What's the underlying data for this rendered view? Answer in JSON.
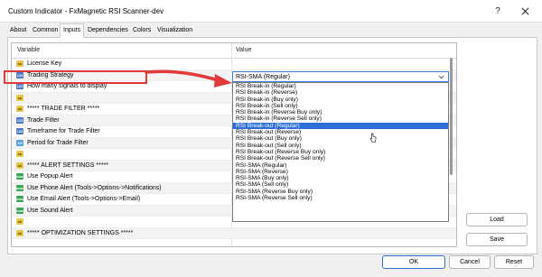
{
  "window": {
    "title": "Custom Indicator - FxMagnetic RSI Scanner-dev",
    "help": "?",
    "close_icon": "close-icon"
  },
  "tabs": [
    {
      "label": "About",
      "active": false
    },
    {
      "label": "Common",
      "active": false
    },
    {
      "label": "Inputs",
      "active": true
    },
    {
      "label": "Dependencies",
      "active": false
    },
    {
      "label": "Colors",
      "active": false
    },
    {
      "label": "Visualization",
      "active": false
    }
  ],
  "grid": {
    "header_variable": "Variable",
    "header_value": "Value",
    "rows": [
      {
        "icon": "ab",
        "label": "License Key",
        "value": ""
      },
      {
        "icon": "123",
        "label": "Trading Strategy",
        "value": "RSI-SMA (Regular)"
      },
      {
        "icon": "123",
        "label": "How many signals to display",
        "value": ""
      },
      {
        "icon": "ab",
        "label": "",
        "value": ""
      },
      {
        "icon": "ab",
        "label": "***** TRADE FILTER *****",
        "value": ""
      },
      {
        "icon": "123",
        "label": "Trade Filter",
        "value": ""
      },
      {
        "icon": "123",
        "label": "Timeframe for Trade Filter",
        "value": ""
      },
      {
        "icon": "1/2",
        "label": "Period for Trade Filter",
        "value": ""
      },
      {
        "icon": "ab",
        "label": "",
        "value": ""
      },
      {
        "icon": "ab",
        "label": "***** ALERT SETTINGS *****",
        "value": ""
      },
      {
        "icon": "bool",
        "label": "Use Popup Alert",
        "value": ""
      },
      {
        "icon": "bool",
        "label": "Use Phone Alert (Tools->Options->Notifications)",
        "value": ""
      },
      {
        "icon": "bool",
        "label": "Use Email Alert (Tools->Options->Email)",
        "value": ""
      },
      {
        "icon": "bool",
        "label": "Use Sound Alert",
        "value": ""
      },
      {
        "icon": "ab",
        "label": "",
        "value": ""
      },
      {
        "icon": "ab",
        "label": "***** OPTIMIZATION SETTINGS *****",
        "value": ""
      }
    ]
  },
  "combo": {
    "value": "RSI-SMA (Regular)",
    "options": [
      "RSI Break-in (Regular)",
      "RSI Break-in (Reverse)",
      "RSI Break-in (Buy only)",
      "RSI Break-in (Sell only)",
      "RSI Break-in (Reverse Buy only)",
      "RSI Break-in (Reverse Sell only)",
      "RSI Break-out (Regular)",
      "RSI Break-out (Reverse)",
      "RSI Break-out (Buy only)",
      "RSI Break-out (Sell only)",
      "RSI Break-out (Reverse Buy only)",
      "RSI Break-out (Reverse Sell only)",
      "RSI-SMA (Regular)",
      "RSI-SMA (Reverse)",
      "RSI-SMA (Buy only)",
      "RSI-SMA (Sell only)",
      "RSI-SMA (Reverse Buy only)",
      "RSI-SMA (Reverse Sell only)"
    ],
    "highlighted_index": 6
  },
  "buttons": {
    "load": "Load",
    "save": "Save",
    "ok": "OK",
    "cancel": "Cancel",
    "reset": "Reset"
  },
  "colors": {
    "annotation": "#e23a3a",
    "selection": "#2b6fd6"
  }
}
